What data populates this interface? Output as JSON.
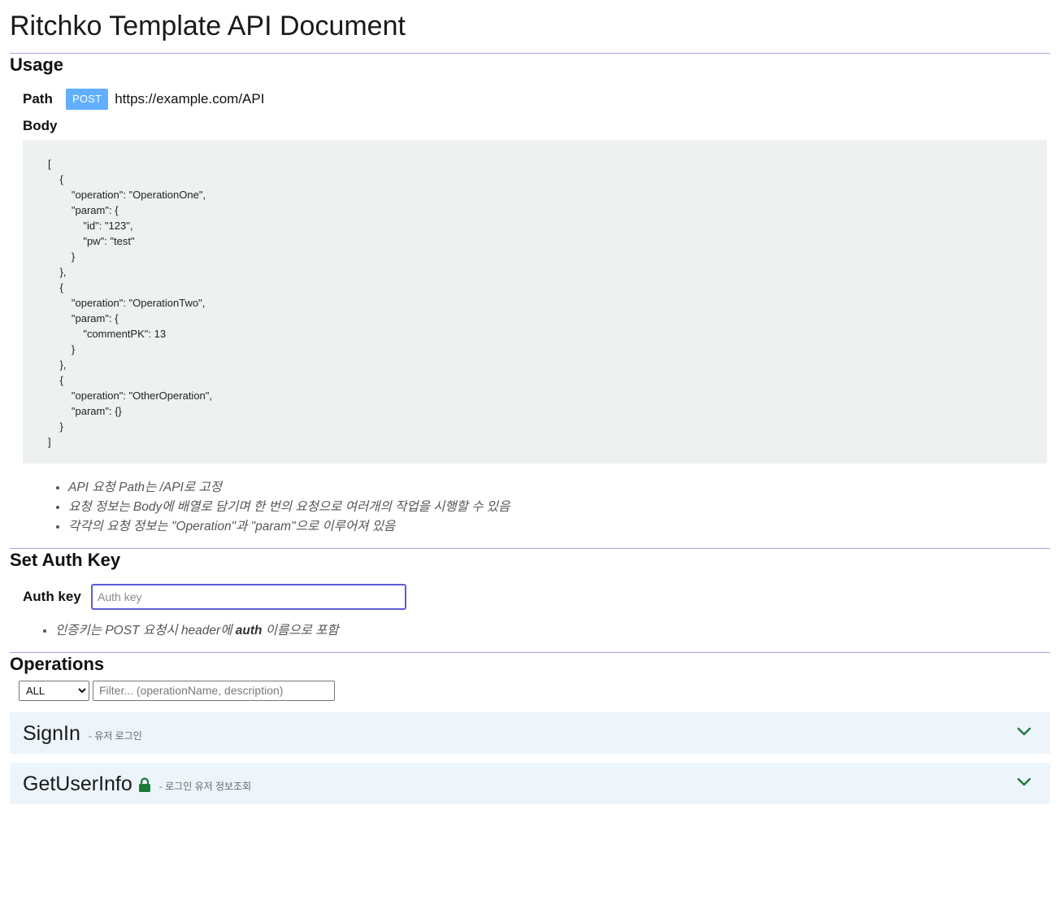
{
  "title": "Ritchko Template API Document",
  "usage": {
    "heading": "Usage",
    "path_label": "Path",
    "method_badge": "POST",
    "url": "https://example.com/API",
    "body_label": "Body",
    "body_code": "[\n    {\n        \"operation\": \"OperationOne\",\n        \"param\": {\n            \"id\": \"123\",\n            \"pw\": \"test\"\n        }\n    },\n    {\n        \"operation\": \"OperationTwo\",\n        \"param\": {\n            \"commentPK\": 13\n        }\n    },\n    {\n        \"operation\": \"OtherOperation\",\n        \"param\": {}\n    }\n]",
    "notes": [
      "API 요청 Path는 /API로 고정",
      "요청 정보는 Body에 배열로 담기며 한 번의 요청으로 여러개의 작업을 시행할 수 있음",
      "각각의 요청 정보는 \"Operation\"과 \"param\"으로 이루어져 있음"
    ]
  },
  "auth": {
    "heading": "Set Auth Key",
    "label": "Auth key",
    "placeholder": "Auth key",
    "value": "",
    "note_prefix": "인증키는 POST 요청시 header에 ",
    "note_bold": "auth",
    "note_suffix": " 이름으로 포함"
  },
  "operations": {
    "heading": "Operations",
    "filter_select": "ALL",
    "filter_placeholder": "Filter... (operationName, description)",
    "items": [
      {
        "name": "SignIn",
        "description": "- 유저 로그인",
        "locked": false
      },
      {
        "name": "GetUserInfo",
        "description": "- 로그인 유저 정보조회",
        "locked": true
      }
    ]
  },
  "colors": {
    "rule": "#a5a3e2",
    "post_badge": "#61affe",
    "code_bg": "#edf2f1",
    "op_card_bg": "#edf5fc",
    "lock": "#1b7a3a",
    "chevron": "#1b7a3a",
    "auth_input_border": "#5c5cd6"
  }
}
